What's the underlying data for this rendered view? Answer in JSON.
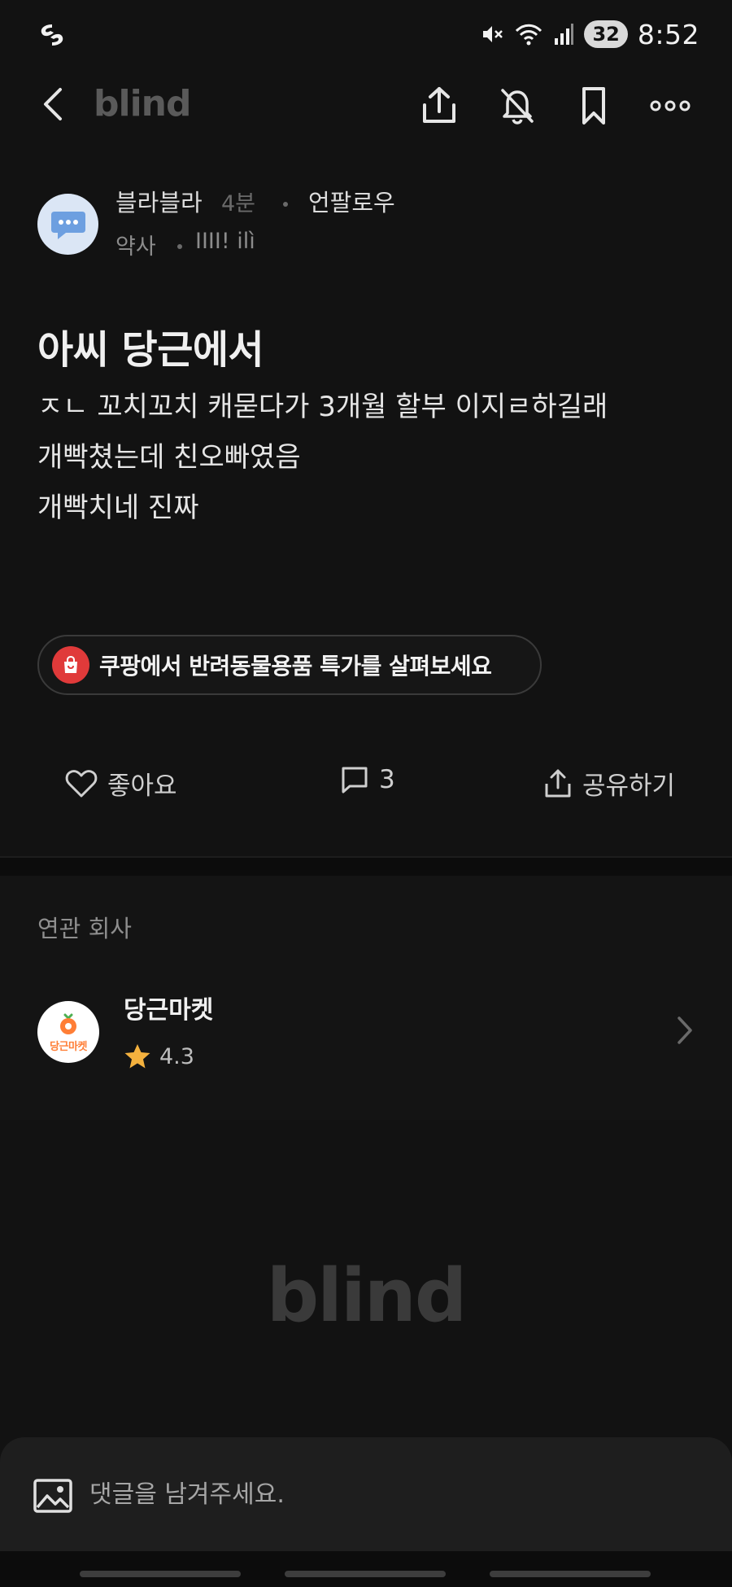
{
  "status_bar": {
    "battery_level": "32",
    "time": "8:52",
    "icons": [
      "swirl-app-icon",
      "mute-icon",
      "wifi-icon",
      "signal-icon",
      "battery-icon"
    ]
  },
  "nav": {
    "brand": "blind",
    "icons": [
      "back-icon",
      "share-icon",
      "notification-off-icon",
      "bookmark-icon",
      "more-icon"
    ]
  },
  "author": {
    "name": "블라블라",
    "time": "4분",
    "unfollow_label": "언팔로우",
    "job": "약사",
    "badge": "IIII! ilì"
  },
  "post": {
    "title": "아씨 당근에서",
    "body_lines": [
      "ㅈㄴ 꼬치꼬치 캐묻다가 3개월 할부 이지ㄹ하길래",
      "개빡쳤는데 친오빠였음",
      "개빡치네 진짜"
    ]
  },
  "ad": {
    "label": "쿠팡에서 반려동물용품 특가를 살펴보세요",
    "icon": "shopping-bag-icon",
    "icon_color": "#e03a3a"
  },
  "actions": {
    "like_label": "좋아요",
    "comment_count": "3",
    "share_label": "공유하기"
  },
  "related": {
    "heading": "연관 회사",
    "company": {
      "name": "당근마켓",
      "logo_text": "당근마켓",
      "rating": "4.3",
      "accent": "#ff7e36"
    }
  },
  "footer": {
    "brand": "blind"
  },
  "comment": {
    "placeholder": "댓글을 남겨주세요."
  }
}
